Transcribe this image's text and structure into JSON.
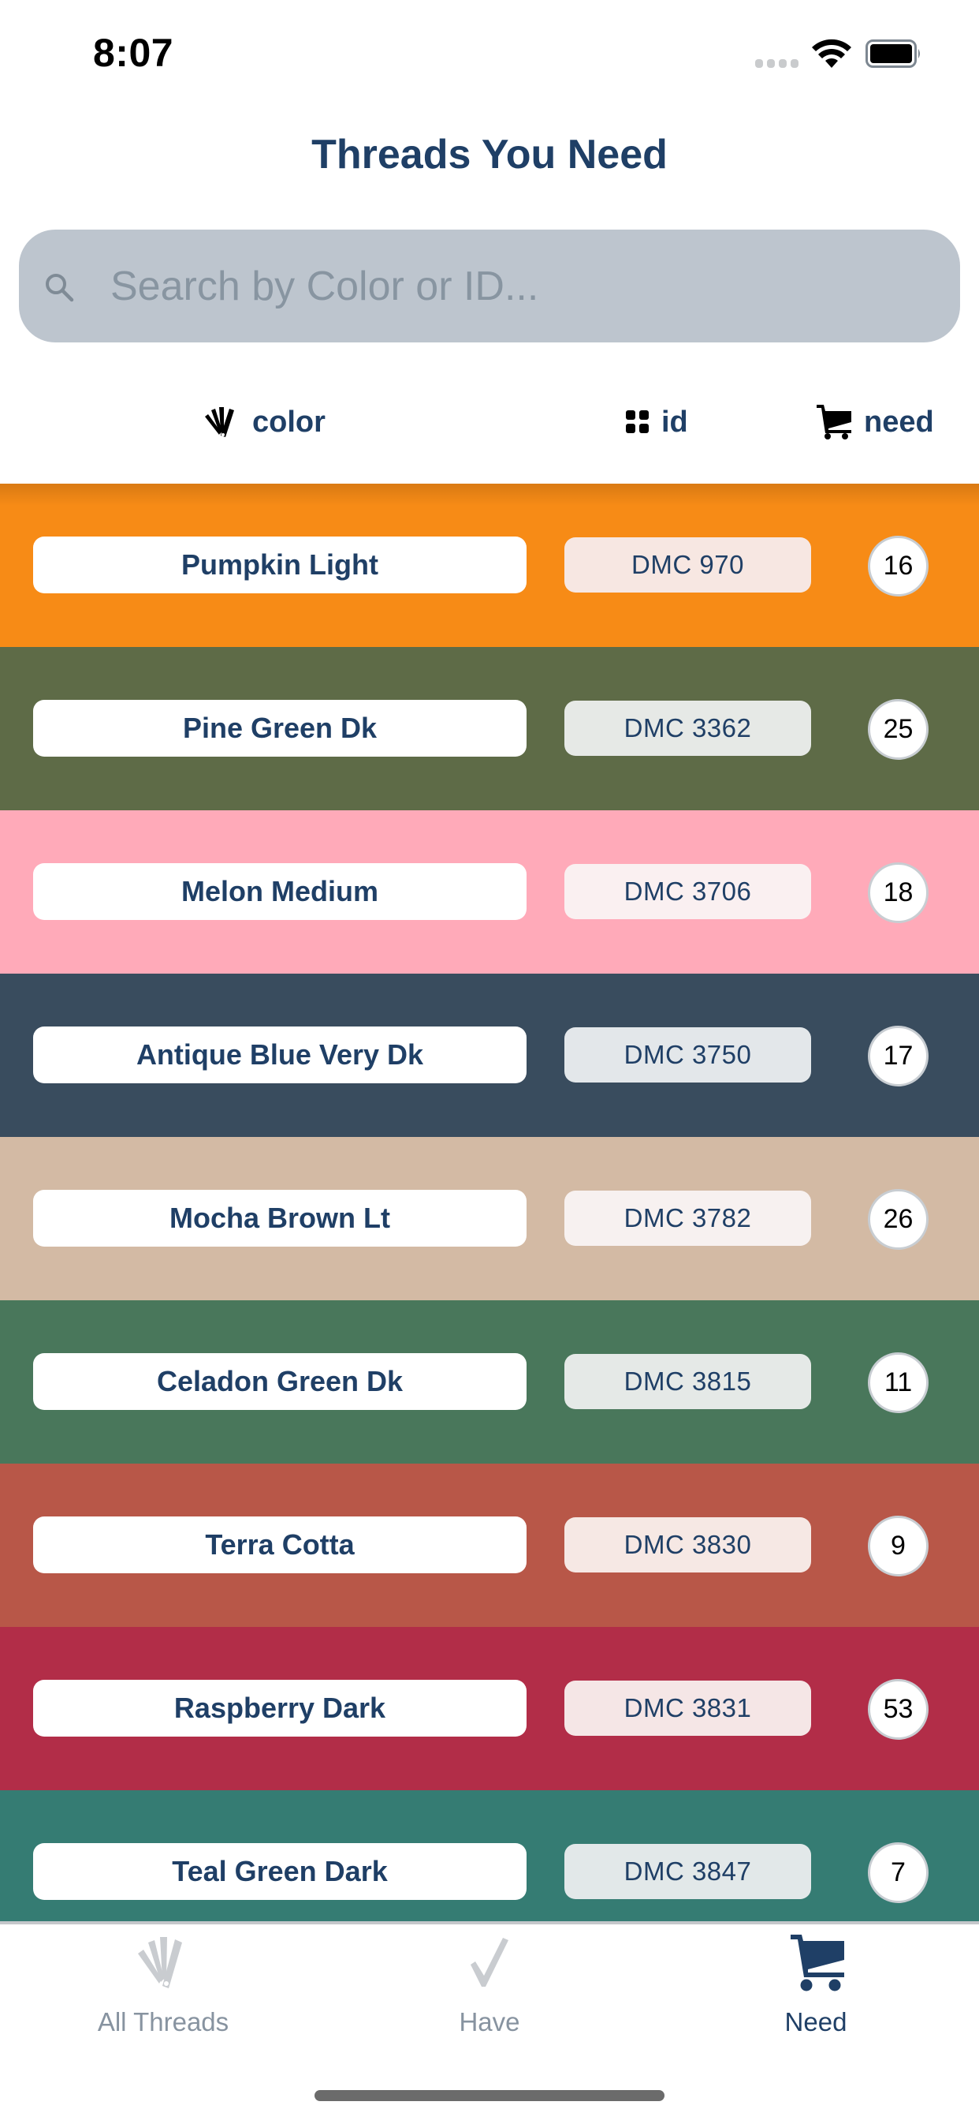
{
  "status_bar": {
    "time": "8:07"
  },
  "header": {
    "title": "Threads You Need"
  },
  "search": {
    "placeholder": "Search by Color or ID...",
    "value": ""
  },
  "sort": {
    "color_label": "color",
    "id_label": "id",
    "need_label": "need"
  },
  "threads": [
    {
      "name": "Pumpkin Light",
      "id": "DMC 970",
      "need": "16",
      "color": "#f78b16",
      "id_bg": "#f7e7e2"
    },
    {
      "name": "Pine Green Dk",
      "id": "DMC 3362",
      "need": "25",
      "color": "#5e6b47",
      "id_bg": "#e6e9e6"
    },
    {
      "name": "Melon Medium",
      "id": "DMC 3706",
      "need": "18",
      "color": "#ffaab9",
      "id_bg": "#faf0f1"
    },
    {
      "name": "Antique Blue Very Dk",
      "id": "DMC 3750",
      "need": "17",
      "color": "#394c5e",
      "id_bg": "#e3e7ea"
    },
    {
      "name": "Mocha Brown Lt",
      "id": "DMC 3782",
      "need": "26",
      "color": "#d3baa4",
      "id_bg": "#f7f1f0"
    },
    {
      "name": "Celadon Green Dk",
      "id": "DMC 3815",
      "need": "11",
      "color": "#49775b",
      "id_bg": "#e5e9e7"
    },
    {
      "name": "Terra Cotta",
      "id": "DMC 3830",
      "need": "9",
      "color": "#b85748",
      "id_bg": "#f6e8e4"
    },
    {
      "name": "Raspberry Dark",
      "id": "DMC 3831",
      "need": "53",
      "color": "#b22d48",
      "id_bg": "#f5e6e6"
    },
    {
      "name": "Teal Green Dark",
      "id": "DMC 3847",
      "need": "7",
      "color": "#357c73",
      "id_bg": "#e2e8e9"
    }
  ],
  "tabs": [
    {
      "label": "All Threads",
      "icon": "thread-fan-icon",
      "active": false
    },
    {
      "label": "Have",
      "icon": "checkmark-icon",
      "active": false
    },
    {
      "label": "Need",
      "icon": "cart-icon",
      "active": true
    }
  ],
  "colors": {
    "accent": "#1f3f66",
    "inactive_tab": "#c9ccd0",
    "search_bg": "#bdc5ce"
  }
}
